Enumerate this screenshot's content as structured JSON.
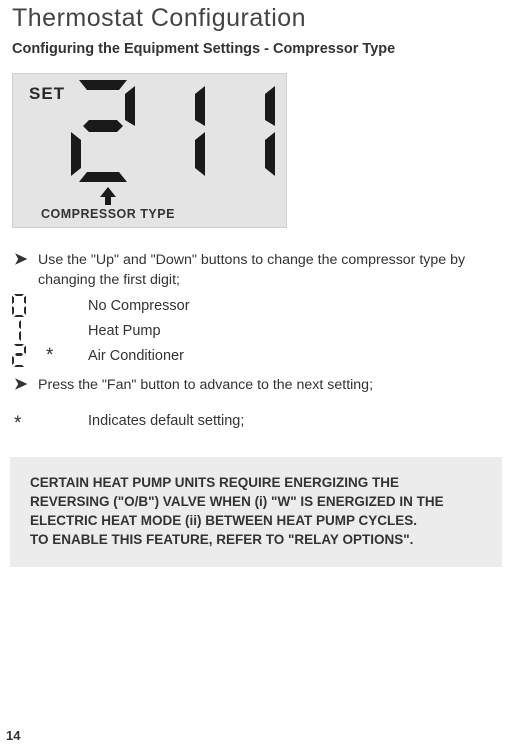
{
  "title": "Thermostat Configuration",
  "subtitle": "Configuring the Equipment Settings - Compressor Type",
  "lcd": {
    "set_label": "SET",
    "digits": "211",
    "caption": "COMPRESSOR TYPE"
  },
  "instruction_use": "Use the \"Up\" and \"Down\" buttons to change the compressor type by changing the first digit;",
  "options": [
    {
      "digit": "0",
      "star": "",
      "label": "No Compressor"
    },
    {
      "digit": "1",
      "star": "",
      "label": "Heat Pump"
    },
    {
      "digit": "2",
      "star": "*",
      "label": "Air Conditioner"
    }
  ],
  "instruction_press": "Press the \"Fan\" button to advance to the next setting;",
  "default_star": "*",
  "default_text": "Indicates default setting;",
  "note_l1": "CERTAIN HEAT PUMP UNITS REQUIRE ENERGIZING THE",
  "note_l2": "REVERSING (\"O/B\") VALVE WHEN (i) \"W\" IS ENERGIZED IN THE",
  "note_l3": "ELECTRIC HEAT MODE (ii) BETWEEN HEAT PUMP CYCLES.",
  "note_l4": "TO ENABLE THIS FEATURE, REFER TO \"RELAY OPTIONS\".",
  "page_number": "14"
}
